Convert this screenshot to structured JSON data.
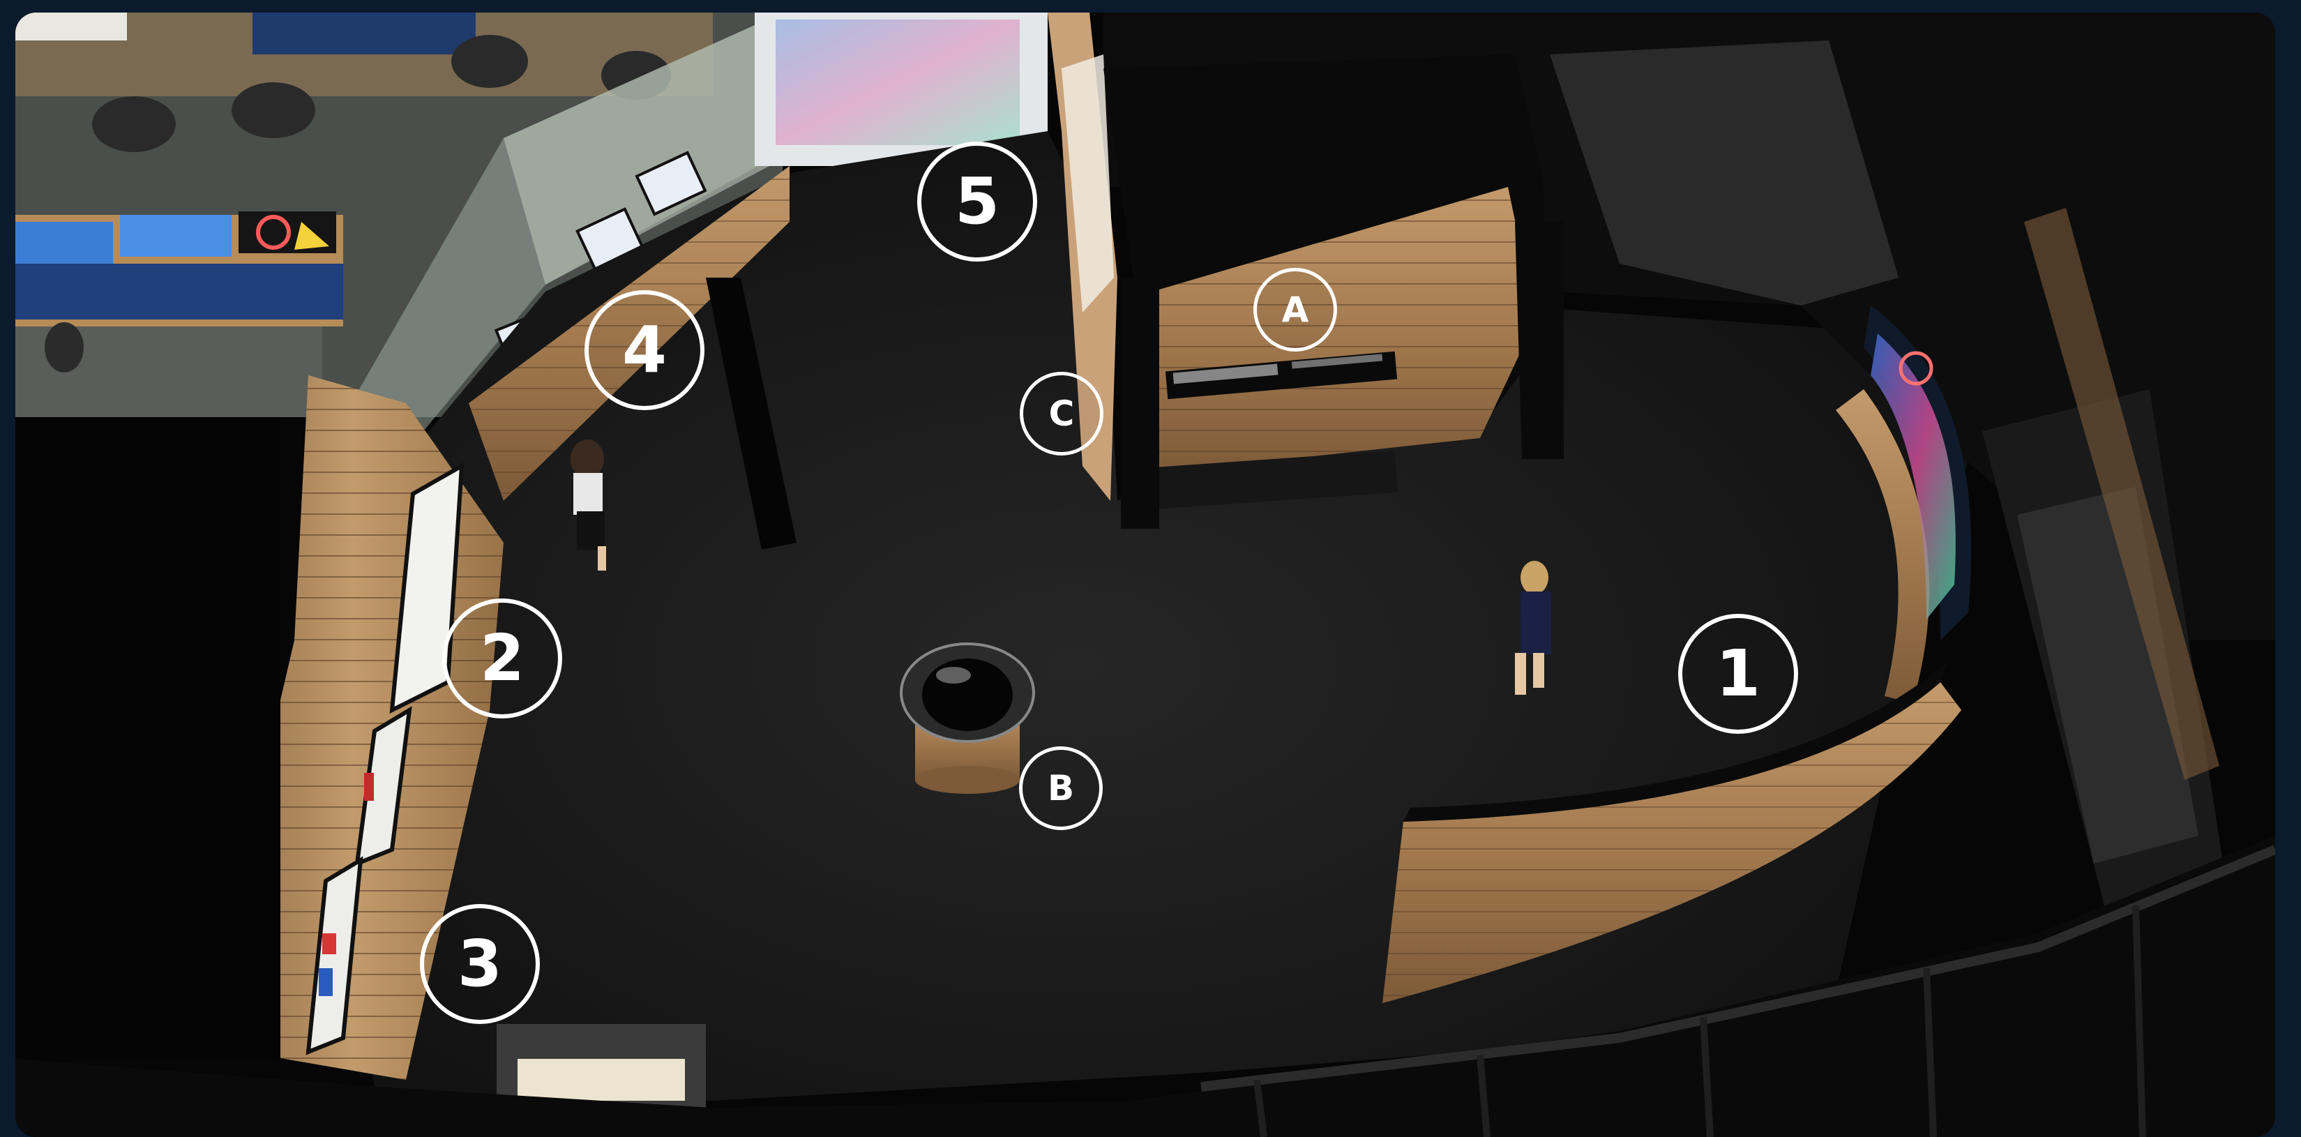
{
  "floorplan": {
    "numbered_markers": [
      {
        "id": "marker-1",
        "label": "1"
      },
      {
        "id": "marker-2",
        "label": "2"
      },
      {
        "id": "marker-3",
        "label": "3"
      },
      {
        "id": "marker-4",
        "label": "4"
      },
      {
        "id": "marker-5",
        "label": "5"
      }
    ],
    "lettered_markers": [
      {
        "id": "marker-a",
        "label": "A"
      },
      {
        "id": "marker-b",
        "label": "B"
      },
      {
        "id": "marker-c",
        "label": "C"
      }
    ]
  },
  "colors": {
    "page_background": "#0b1a2c",
    "floor": "#1c1c1c",
    "wood_panel": "#a8845c",
    "marker_outline": "#ffffff"
  }
}
